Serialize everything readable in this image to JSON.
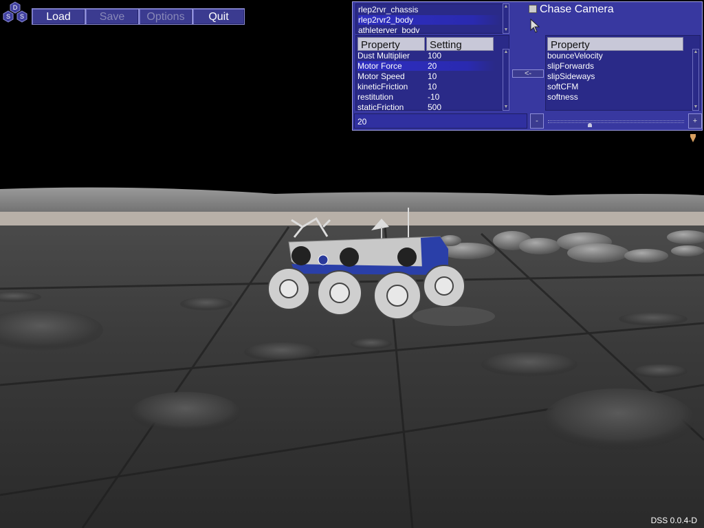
{
  "toolbar": {
    "logo_letters": [
      "D",
      "S",
      "S"
    ],
    "load_label": "Load",
    "save_label": "Save",
    "options_label": "Options",
    "quit_label": "Quit"
  },
  "objects_list": [
    "rlep2rvr_chassis",
    "rlep2rvr2_body",
    "athleterver_body"
  ],
  "selected_object_index": 1,
  "chase_camera_label": "Chase Camera",
  "chase_camera_checked": false,
  "left_table": {
    "header_property": "Property",
    "header_setting": "Setting",
    "rows": [
      {
        "property": "Dust Multiplier",
        "setting": "100"
      },
      {
        "property": "Motor Force",
        "setting": "20"
      },
      {
        "property": "Motor Speed",
        "setting": "10"
      },
      {
        "property": "kineticFriction",
        "setting": "10"
      },
      {
        "property": "restitution",
        "setting": "-10"
      },
      {
        "property": "staticFriction",
        "setting": "500"
      }
    ],
    "selected_row_index": 1
  },
  "move_button_label": "<-",
  "right_table": {
    "header_property": "Property",
    "rows": [
      "bounceVelocity",
      "slipForwards",
      "slipSideways",
      "softCFM",
      "softness"
    ]
  },
  "value_field": "20",
  "minus_label": "-",
  "plus_label": "+",
  "slider_level": 0.3,
  "version": "DSS 0.0.4-D"
}
